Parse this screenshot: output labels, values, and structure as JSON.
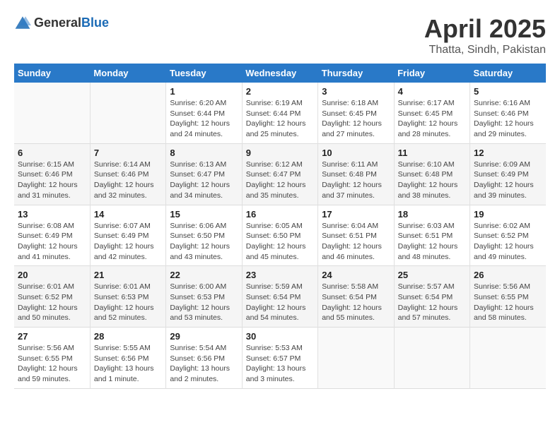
{
  "header": {
    "logo_general": "General",
    "logo_blue": "Blue",
    "title": "April 2025",
    "subtitle": "Thatta, Sindh, Pakistan"
  },
  "calendar": {
    "days_of_week": [
      "Sunday",
      "Monday",
      "Tuesday",
      "Wednesday",
      "Thursday",
      "Friday",
      "Saturday"
    ],
    "weeks": [
      [
        {
          "num": "",
          "detail": ""
        },
        {
          "num": "",
          "detail": ""
        },
        {
          "num": "1",
          "detail": "Sunrise: 6:20 AM\nSunset: 6:44 PM\nDaylight: 12 hours and 24 minutes."
        },
        {
          "num": "2",
          "detail": "Sunrise: 6:19 AM\nSunset: 6:44 PM\nDaylight: 12 hours and 25 minutes."
        },
        {
          "num": "3",
          "detail": "Sunrise: 6:18 AM\nSunset: 6:45 PM\nDaylight: 12 hours and 27 minutes."
        },
        {
          "num": "4",
          "detail": "Sunrise: 6:17 AM\nSunset: 6:45 PM\nDaylight: 12 hours and 28 minutes."
        },
        {
          "num": "5",
          "detail": "Sunrise: 6:16 AM\nSunset: 6:46 PM\nDaylight: 12 hours and 29 minutes."
        }
      ],
      [
        {
          "num": "6",
          "detail": "Sunrise: 6:15 AM\nSunset: 6:46 PM\nDaylight: 12 hours and 31 minutes."
        },
        {
          "num": "7",
          "detail": "Sunrise: 6:14 AM\nSunset: 6:46 PM\nDaylight: 12 hours and 32 minutes."
        },
        {
          "num": "8",
          "detail": "Sunrise: 6:13 AM\nSunset: 6:47 PM\nDaylight: 12 hours and 34 minutes."
        },
        {
          "num": "9",
          "detail": "Sunrise: 6:12 AM\nSunset: 6:47 PM\nDaylight: 12 hours and 35 minutes."
        },
        {
          "num": "10",
          "detail": "Sunrise: 6:11 AM\nSunset: 6:48 PM\nDaylight: 12 hours and 37 minutes."
        },
        {
          "num": "11",
          "detail": "Sunrise: 6:10 AM\nSunset: 6:48 PM\nDaylight: 12 hours and 38 minutes."
        },
        {
          "num": "12",
          "detail": "Sunrise: 6:09 AM\nSunset: 6:49 PM\nDaylight: 12 hours and 39 minutes."
        }
      ],
      [
        {
          "num": "13",
          "detail": "Sunrise: 6:08 AM\nSunset: 6:49 PM\nDaylight: 12 hours and 41 minutes."
        },
        {
          "num": "14",
          "detail": "Sunrise: 6:07 AM\nSunset: 6:49 PM\nDaylight: 12 hours and 42 minutes."
        },
        {
          "num": "15",
          "detail": "Sunrise: 6:06 AM\nSunset: 6:50 PM\nDaylight: 12 hours and 43 minutes."
        },
        {
          "num": "16",
          "detail": "Sunrise: 6:05 AM\nSunset: 6:50 PM\nDaylight: 12 hours and 45 minutes."
        },
        {
          "num": "17",
          "detail": "Sunrise: 6:04 AM\nSunset: 6:51 PM\nDaylight: 12 hours and 46 minutes."
        },
        {
          "num": "18",
          "detail": "Sunrise: 6:03 AM\nSunset: 6:51 PM\nDaylight: 12 hours and 48 minutes."
        },
        {
          "num": "19",
          "detail": "Sunrise: 6:02 AM\nSunset: 6:52 PM\nDaylight: 12 hours and 49 minutes."
        }
      ],
      [
        {
          "num": "20",
          "detail": "Sunrise: 6:01 AM\nSunset: 6:52 PM\nDaylight: 12 hours and 50 minutes."
        },
        {
          "num": "21",
          "detail": "Sunrise: 6:01 AM\nSunset: 6:53 PM\nDaylight: 12 hours and 52 minutes."
        },
        {
          "num": "22",
          "detail": "Sunrise: 6:00 AM\nSunset: 6:53 PM\nDaylight: 12 hours and 53 minutes."
        },
        {
          "num": "23",
          "detail": "Sunrise: 5:59 AM\nSunset: 6:54 PM\nDaylight: 12 hours and 54 minutes."
        },
        {
          "num": "24",
          "detail": "Sunrise: 5:58 AM\nSunset: 6:54 PM\nDaylight: 12 hours and 55 minutes."
        },
        {
          "num": "25",
          "detail": "Sunrise: 5:57 AM\nSunset: 6:54 PM\nDaylight: 12 hours and 57 minutes."
        },
        {
          "num": "26",
          "detail": "Sunrise: 5:56 AM\nSunset: 6:55 PM\nDaylight: 12 hours and 58 minutes."
        }
      ],
      [
        {
          "num": "27",
          "detail": "Sunrise: 5:56 AM\nSunset: 6:55 PM\nDaylight: 12 hours and 59 minutes."
        },
        {
          "num": "28",
          "detail": "Sunrise: 5:55 AM\nSunset: 6:56 PM\nDaylight: 13 hours and 1 minute."
        },
        {
          "num": "29",
          "detail": "Sunrise: 5:54 AM\nSunset: 6:56 PM\nDaylight: 13 hours and 2 minutes."
        },
        {
          "num": "30",
          "detail": "Sunrise: 5:53 AM\nSunset: 6:57 PM\nDaylight: 13 hours and 3 minutes."
        },
        {
          "num": "",
          "detail": ""
        },
        {
          "num": "",
          "detail": ""
        },
        {
          "num": "",
          "detail": ""
        }
      ]
    ]
  }
}
